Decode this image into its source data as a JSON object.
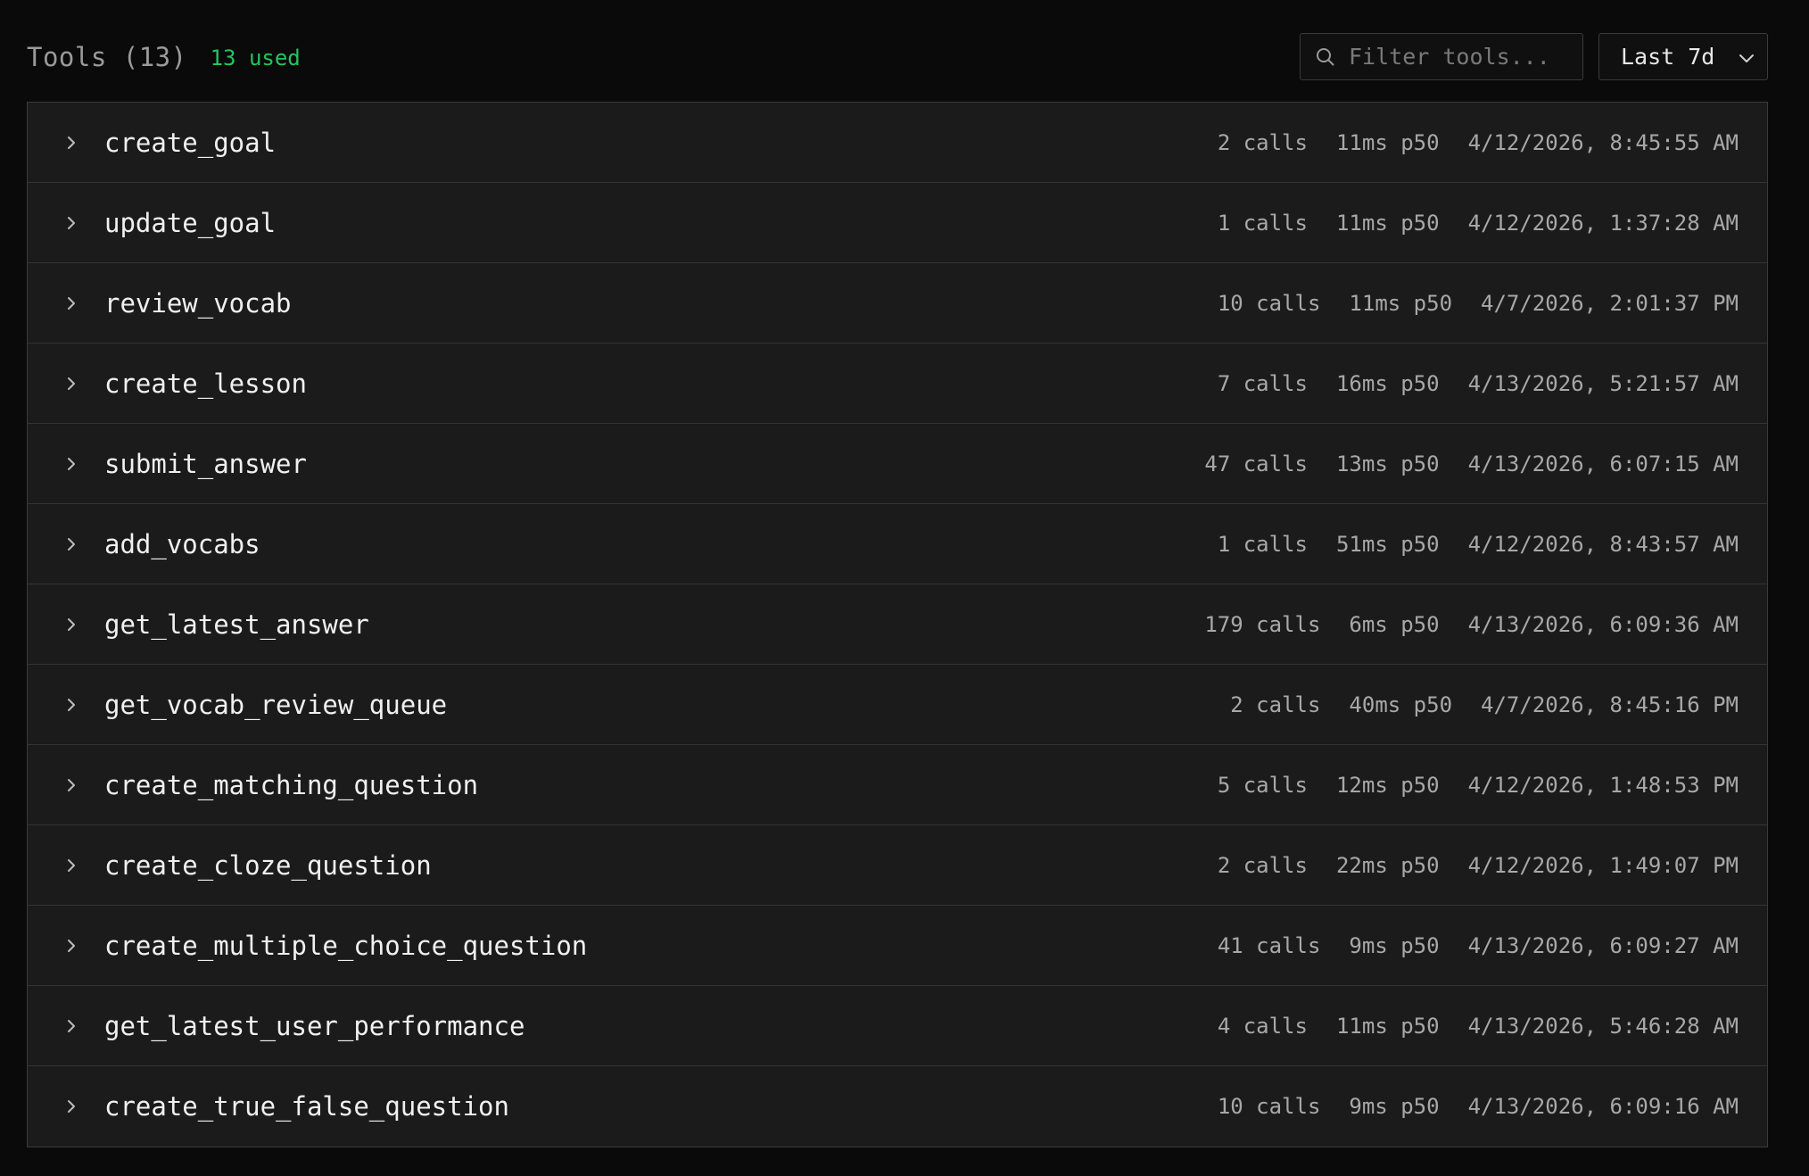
{
  "header": {
    "title": "Tools (13)",
    "used": "13 used",
    "filter_placeholder": "Filter tools...",
    "range_selected": "Last 7d"
  },
  "tools": [
    {
      "name": "create_goal",
      "calls": "2 calls",
      "p50": "11ms p50",
      "last": "4/12/2026, 8:45:55 AM"
    },
    {
      "name": "update_goal",
      "calls": "1 calls",
      "p50": "11ms p50",
      "last": "4/12/2026, 1:37:28 AM"
    },
    {
      "name": "review_vocab",
      "calls": "10 calls",
      "p50": "11ms p50",
      "last": "4/7/2026, 2:01:37 PM"
    },
    {
      "name": "create_lesson",
      "calls": "7 calls",
      "p50": "16ms p50",
      "last": "4/13/2026, 5:21:57 AM"
    },
    {
      "name": "submit_answer",
      "calls": "47 calls",
      "p50": "13ms p50",
      "last": "4/13/2026, 6:07:15 AM"
    },
    {
      "name": "add_vocabs",
      "calls": "1 calls",
      "p50": "51ms p50",
      "last": "4/12/2026, 8:43:57 AM"
    },
    {
      "name": "get_latest_answer",
      "calls": "179 calls",
      "p50": "6ms p50",
      "last": "4/13/2026, 6:09:36 AM"
    },
    {
      "name": "get_vocab_review_queue",
      "calls": "2 calls",
      "p50": "40ms p50",
      "last": "4/7/2026, 8:45:16 PM"
    },
    {
      "name": "create_matching_question",
      "calls": "5 calls",
      "p50": "12ms p50",
      "last": "4/12/2026, 1:48:53 PM"
    },
    {
      "name": "create_cloze_question",
      "calls": "2 calls",
      "p50": "22ms p50",
      "last": "4/12/2026, 1:49:07 PM"
    },
    {
      "name": "create_multiple_choice_question",
      "calls": "41 calls",
      "p50": "9ms p50",
      "last": "4/13/2026, 6:09:27 AM"
    },
    {
      "name": "get_latest_user_performance",
      "calls": "4 calls",
      "p50": "11ms p50",
      "last": "4/13/2026, 5:46:28 AM"
    },
    {
      "name": "create_true_false_question",
      "calls": "10 calls",
      "p50": "9ms p50",
      "last": "4/13/2026, 6:09:16 AM"
    }
  ]
}
